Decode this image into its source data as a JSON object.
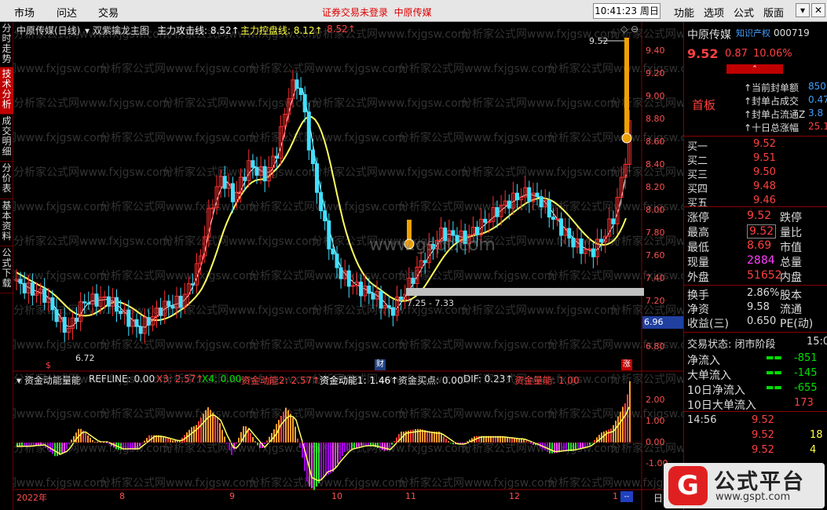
{
  "menu": {
    "items": [
      "市场",
      "问达",
      "交易"
    ],
    "notice": "证券交易未登录",
    "stock_tab": "中原传媒",
    "clock": "10:41:23 周日",
    "right_items": [
      "功能",
      "选项",
      "公式",
      "版面"
    ]
  },
  "left_tabs": [
    "分时走势",
    "技术分析",
    "成交明细",
    "分价表",
    "基本资料",
    "公式下载"
  ],
  "main": {
    "title": "中原传媒(日线)",
    "indicator": "双紫擒龙主图",
    "line1": "主力攻击线: 8.52↑",
    "line2": "主力控盘线: 8.12↑",
    "line3": "8.52↑",
    "yticks": [
      "9.40",
      "9.20",
      "9.00",
      "8.80",
      "8.60",
      "8.40",
      "8.20",
      "8.00",
      "7.80",
      "7.60",
      "7.40",
      "7.20",
      "7.00",
      "6.80"
    ],
    "price_box": "6.96",
    "high_label": "9.52",
    "low_label": "6.72",
    "range_label": "7.25 - 7.33",
    "watermark": "www.gspt.com",
    "markers": [
      "$",
      "财",
      "涨"
    ]
  },
  "sub": {
    "name": "资金动能量能",
    "refline": "REFLINE: 0.00",
    "x3": "X3: 2.57↑",
    "x4": "X4: 0.00",
    "f2": "资金动能2: 2.57↑",
    "f1": "资金动能1: 1.46↑",
    "buy": "资金买点: 0.00",
    "dif": "DIF: 0.23↑",
    "vol": "资金量能: 1.00",
    "yticks": [
      "2.00",
      "1.00",
      "0.00",
      "-1.00"
    ]
  },
  "xaxis": [
    "2022年",
    "8",
    "9",
    "10",
    "11",
    "12",
    "1"
  ],
  "day_btn": "日",
  "quote": {
    "name": "中原传媒",
    "tag": "知识产权",
    "code": "000719",
    "price": "9.52",
    "change": "0.87",
    "pct": "10.06%",
    "board": "首板",
    "limit_info": [
      [
        "当前封单额",
        "850"
      ],
      [
        "封单占成交",
        "0.47"
      ],
      [
        "封单占流通Z",
        "3.8"
      ],
      [
        "十日总涨幅",
        "25.1"
      ]
    ],
    "bids": [
      [
        "买一",
        "9.52"
      ],
      [
        "买二",
        "9.51"
      ],
      [
        "买三",
        "9.50"
      ],
      [
        "买四",
        "9.48"
      ],
      [
        "买五",
        "9.46"
      ]
    ],
    "stats": [
      [
        "涨停",
        "9.52",
        "跌停",
        ""
      ],
      [
        "最高",
        "9.52",
        "量比",
        ""
      ],
      [
        "最低",
        "8.69",
        "市值",
        ""
      ],
      [
        "现量",
        "2884",
        "总量",
        ""
      ],
      [
        "外盘",
        "51652",
        "内盘",
        ""
      ]
    ],
    "fin": [
      [
        "换手",
        "2.86%",
        "股本"
      ],
      [
        "净资",
        "9.58",
        "流通"
      ],
      [
        "收益(三)",
        "0.650",
        "PE(动)"
      ]
    ],
    "trade_status": "交易状态: 闭市阶段",
    "trade_time": "15:0",
    "flows": [
      [
        "净流入",
        "-851"
      ],
      [
        "大单流入",
        "-145"
      ],
      [
        "10日净流入",
        "-655"
      ],
      [
        "10日大单流入",
        "173"
      ]
    ],
    "ticks": [
      [
        "14:56",
        "9.52",
        ""
      ],
      [
        "",
        "9.52",
        "18"
      ],
      [
        "",
        "9.52",
        "4"
      ]
    ]
  },
  "logo": {
    "text": "公式平台",
    "url": "www.gspt.com"
  },
  "chart_data": {
    "type": "candlestick",
    "ylim": [
      6.6,
      9.6
    ],
    "last_close": 9.52,
    "high": 9.52,
    "low": 6.72
  }
}
